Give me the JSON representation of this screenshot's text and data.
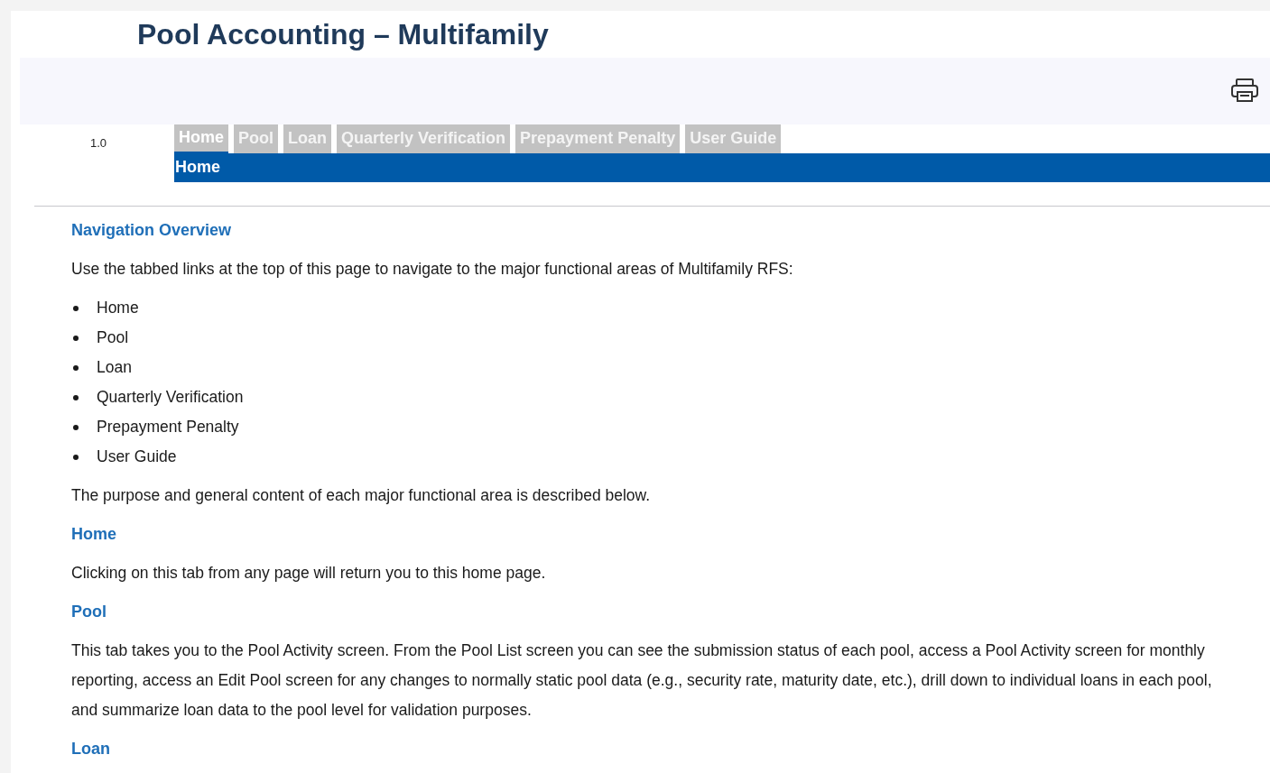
{
  "title": "Pool Accounting – Multifamily",
  "version": "1.0",
  "tabs": [
    {
      "label": "Home",
      "selected": true
    },
    {
      "label": "Pool",
      "selected": false
    },
    {
      "label": "Loan",
      "selected": false
    },
    {
      "label": "Quarterly Verification",
      "selected": false
    },
    {
      "label": "Prepayment Penalty",
      "selected": false
    },
    {
      "label": "User Guide",
      "selected": false
    }
  ],
  "subnav_label": "Home",
  "content": [
    {
      "kind": "heading",
      "text": "Navigation Overview"
    },
    {
      "kind": "paragraph",
      "text": "Use the tabbed links at the top of this page to navigate to the major functional areas of Multifamily RFS:"
    },
    {
      "kind": "list",
      "items": [
        "Home",
        "Pool",
        "Loan",
        "Quarterly Verification",
        "Prepayment Penalty",
        "User Guide"
      ]
    },
    {
      "kind": "paragraph",
      "text": "The purpose and general content of each major functional area is described below."
    },
    {
      "kind": "heading",
      "text": "Home"
    },
    {
      "kind": "paragraph",
      "text": "Clicking on this tab from any page will return you to this home page."
    },
    {
      "kind": "heading",
      "text": "Pool"
    },
    {
      "kind": "paragraph",
      "text": "This tab takes you to the Pool Activity screen. From the Pool List screen you can see the submission status of  each pool, access a Pool Activity screen for monthly reporting, access an Edit Pool screen for any changes to normally static pool data (e.g., security rate, maturity date, etc.), drill down to individual loans in each pool, and summarize loan data to the pool level for validation purposes."
    },
    {
      "kind": "heading",
      "text": "Loan"
    }
  ]
}
